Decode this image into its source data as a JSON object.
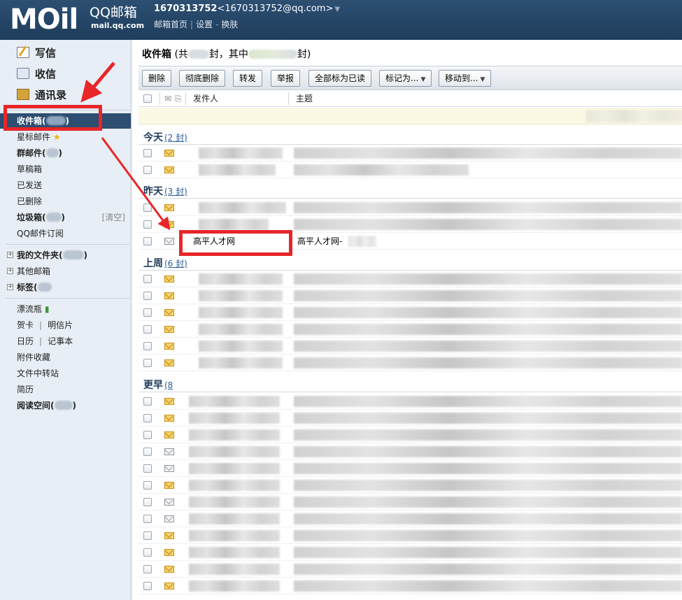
{
  "header": {
    "logo_mark": "MOil",
    "logo_brand": "QQ邮箱",
    "logo_domain": "mail.qq.com",
    "account_number": "1670313752",
    "account_email": "<1670313752@qq.com>",
    "account_caret": "▼",
    "links": [
      "邮箱首页",
      "设置",
      "换肤"
    ]
  },
  "sidebar": {
    "quick": [
      {
        "label": "写信",
        "icon": "compose-icon"
      },
      {
        "label": "收信",
        "icon": "receive-icon"
      },
      {
        "label": "通讯录",
        "icon": "contacts-icon"
      }
    ],
    "folders": {
      "inbox": "收件箱(",
      "inbox_close": ")",
      "starred": "星标邮件",
      "group": "群邮件(",
      "group_close": ")",
      "drafts": "草稿箱",
      "sent": "已发送",
      "deleted": "已删除",
      "spam": "垃圾箱(",
      "spam_close": ")",
      "spam_clear": "[清空]",
      "subscriptions": "QQ邮件订阅"
    },
    "groups": {
      "my_folders": "我的文件夹(",
      "my_folders_close": ")",
      "other_mailboxes": "其他邮箱",
      "tags": "标签(",
      "tags_close": ")"
    },
    "apps": {
      "bottle": "漂流瓶",
      "cards": "贺卡",
      "postcards": "明信片",
      "calendar": "日历",
      "notes": "记事本",
      "attachments": "附件收藏",
      "file_transfer": "文件中转站",
      "resume": "简历",
      "reading": "阅读空间(",
      "reading_close": ")"
    },
    "sep": "|"
  },
  "main": {
    "title": "收件箱",
    "title_mid": "(共",
    "title_mid2": "封，其中",
    "title_end": "封)",
    "toolbar": {
      "delete": "删除",
      "delete_permanently": "彻底删除",
      "forward": "转发",
      "report": "举报",
      "mark_all_read": "全部标为已读",
      "mark_as": "标记为...",
      "move_to": "移动到...",
      "dropdown": "▼"
    },
    "columns": {
      "sender": "发件人",
      "subject": "主题"
    },
    "groups": {
      "today": {
        "label": "今天",
        "count": "(2 封)"
      },
      "yesterday": {
        "label": "昨天",
        "count": "(3 封)"
      },
      "last_week": {
        "label": "上周",
        "count": "(6 封)"
      },
      "earlier": {
        "label": "更早",
        "count": "(8"
      }
    },
    "highlighted_row": {
      "sender": "高平人才网",
      "subject": "高平人才网-"
    }
  },
  "colors": {
    "highlight": "#e8262a",
    "header_bg": "#2c4f72",
    "active_folder_bg": "#2d4e70"
  }
}
